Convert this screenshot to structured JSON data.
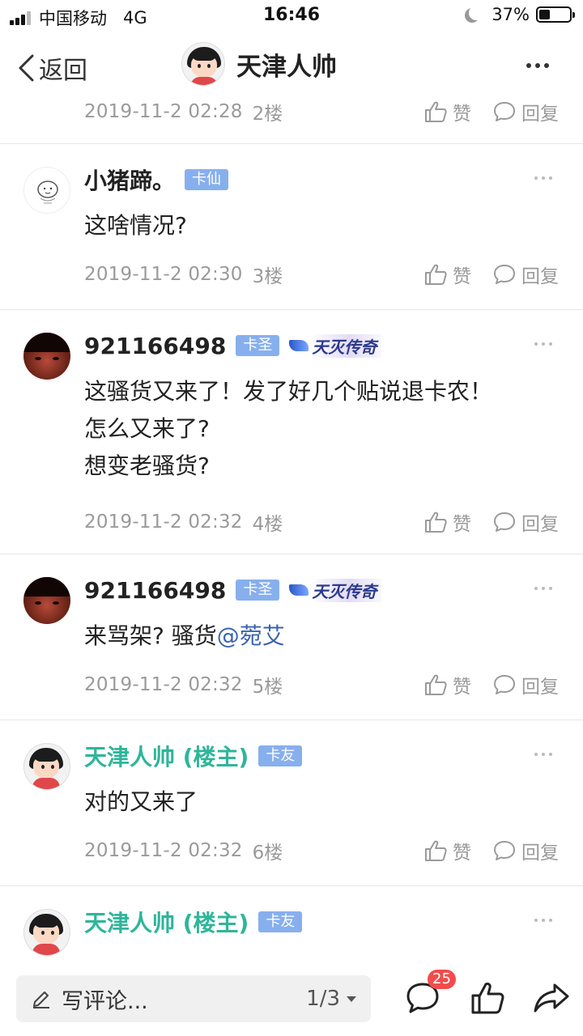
{
  "status_bar": {
    "carrier": "中国移动",
    "network": "4G",
    "time": "16:46",
    "battery": "37%",
    "battery_level": 0.37
  },
  "nav": {
    "back_label": "返回",
    "title": "天津人帅"
  },
  "top_meta": {
    "time": "2019-11-2 02:28",
    "floor": "2楼",
    "like": "赞",
    "reply": "回复"
  },
  "posts": [
    {
      "user": "小猪蹄。",
      "badge": "卡仙",
      "lines": [
        "这啥情况?"
      ],
      "time": "2019-11-2 02:30",
      "floor": "3楼",
      "like": "赞",
      "reply": "回复"
    },
    {
      "user": "921166498",
      "badge": "卡圣",
      "tag": "天灭传奇",
      "lines": [
        "这骚货又来了！发了好几个贴说退卡农！",
        "怎么又来了?",
        "想变老骚货?"
      ],
      "time": "2019-11-2 02:32",
      "floor": "4楼",
      "like": "赞",
      "reply": "回复"
    },
    {
      "user": "921166498",
      "badge": "卡圣",
      "tag": "天灭传奇",
      "text_prefix": "来骂架? 骚货",
      "mention": "@菀艾",
      "time": "2019-11-2 02:32",
      "floor": "5楼",
      "like": "赞",
      "reply": "回复"
    },
    {
      "user": "天津人帅 (楼主)",
      "badge": "卡友",
      "lines": [
        "对的又来了"
      ],
      "time": "2019-11-2 02:32",
      "floor": "6楼",
      "like": "赞",
      "reply": "回复"
    },
    {
      "user": "天津人帅 (楼主)",
      "badge": "卡友"
    }
  ],
  "bottom": {
    "comment_placeholder": "写评论...",
    "page": "1/3",
    "comment_count": "25"
  },
  "colors": {
    "owner_name": "#2fb59a",
    "badge_bg": "#87afee",
    "mention": "#3b63b0",
    "count_badge": "#f24c4c"
  }
}
